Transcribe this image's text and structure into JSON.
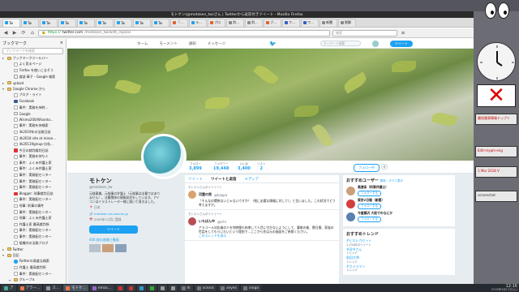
{
  "window": {
    "title": "モトケン(@motoken_tw)さん | Twitterから返答付きツイート - Mozilla Firefox"
  },
  "tabs": [
    {
      "label": "Tw",
      "color": "#1da1f2"
    },
    {
      "label": "Tw",
      "color": "#1da1f2"
    },
    {
      "label": "Tw",
      "color": "#1da1f2"
    },
    {
      "label": "Tw",
      "color": "#1da1f2"
    },
    {
      "label": "Tw",
      "color": "#1da1f2"
    },
    {
      "label": "Tw",
      "color": "#1da1f2"
    },
    {
      "label": "Tw",
      "color": "#1da1f2"
    },
    {
      "label": "Tw",
      "color": "#1da1f2"
    },
    {
      "label": "Tw",
      "color": "#1da1f2"
    },
    {
      "label": "「ホワ",
      "color": "#e06030"
    },
    {
      "label": "ライト",
      "color": "#1da1f2"
    },
    {
      "label": "ブロ",
      "color": "#e06030"
    },
    {
      "label": "判事事",
      "color": "#888888"
    },
    {
      "label": "判事事",
      "color": "#888888"
    },
    {
      "label": "ブログ",
      "color": "#e06030"
    },
    {
      "label": "フジテ",
      "color": "#3060c0"
    },
    {
      "label": "ワイド",
      "color": "#3060c0"
    },
    {
      "label": "新聞",
      "color": "#888888"
    },
    {
      "label": "脱解",
      "color": "#888888"
    }
  ],
  "nav": {
    "back": "◀",
    "forward": "▶",
    "reload": "⟳",
    "home": "⌂",
    "url_scheme": "https://",
    "url_host": "twitter.com",
    "url_path": "/motoken_tw/with_replies",
    "search_placeholder": "検索"
  },
  "sidebar": {
    "title": "ブックマーク",
    "close": "×",
    "search_placeholder": "ブックマークを検索",
    "items": [
      {
        "label": "ブックマークツールバー",
        "icon": "folder",
        "indent": 0,
        "twisty": "▸"
      },
      {
        "label": "よく見るページ",
        "icon": "page",
        "indent": 1,
        "twisty": ""
      },
      {
        "label": "Firefox を使いこなそう",
        "icon": "page",
        "indent": 1,
        "twisty": ""
      },
      {
        "label": "渡部 章子 - Google 検索",
        "icon": "google",
        "indent": 1,
        "twisty": ""
      },
      {
        "label": "upload",
        "icon": "folder",
        "indent": 0,
        "twisty": "▸"
      },
      {
        "label": "Google Chrome から",
        "icon": "folder",
        "indent": 0,
        "twisty": "▾"
      },
      {
        "label": "ブログ・ライト",
        "icon": "page",
        "indent": 1,
        "twisty": ""
      },
      {
        "label": "Facebook",
        "icon": "fb",
        "indent": 1,
        "twisty": ""
      },
      {
        "label": "事件：実務を持時...",
        "icon": "page",
        "indent": 1,
        "twisty": ""
      },
      {
        "label": "Google",
        "icon": "google",
        "indent": 1,
        "twisty": ""
      },
      {
        "label": "Wismo200/Wisonto...",
        "icon": "page",
        "indent": 1,
        "twisty": ""
      },
      {
        "label": "事件：実務を持検索",
        "icon": "page",
        "indent": 1,
        "twisty": ""
      },
      {
        "label": "dk2019年の法務日誌",
        "icon": "page",
        "indent": 1,
        "twisty": ""
      },
      {
        "label": "dk2018 site at misse...",
        "icon": "page",
        "indent": 1,
        "twisty": ""
      },
      {
        "label": "dk20119group-分析...",
        "icon": "page",
        "indent": 1,
        "twisty": ""
      },
      {
        "label": "今日の裁判裁判日誌",
        "icon": "red",
        "indent": 1,
        "twisty": ""
      },
      {
        "label": "事件：実務を持ち人",
        "icon": "page",
        "indent": 1,
        "twisty": ""
      },
      {
        "label": "事件：ふくみ弁護士家",
        "icon": "page",
        "indent": 1,
        "twisty": ""
      },
      {
        "label": "事件：ふくみ弁護士家",
        "icon": "page",
        "indent": 1,
        "twisty": ""
      },
      {
        "label": "事件：実務配センター",
        "icon": "page",
        "indent": 1,
        "twisty": ""
      },
      {
        "label": "事件：実務配センター",
        "icon": "page",
        "indent": 1,
        "twisty": ""
      },
      {
        "label": "事件：実務配センター",
        "icon": "page",
        "indent": 1,
        "twisty": ""
      },
      {
        "label": "Blogger: 刑事裁判日誌",
        "icon": "red",
        "indent": 1,
        "twisty": ""
      },
      {
        "label": "事件：実務配センター",
        "icon": "page",
        "indent": 1,
        "twisty": ""
      },
      {
        "label": "刑事: 刑事の事件",
        "icon": "page",
        "indent": 1,
        "twisty": ""
      },
      {
        "label": "事件：実務配センター",
        "icon": "page",
        "indent": 1,
        "twisty": ""
      },
      {
        "label": "刑事：ふくみ弁護士家",
        "icon": "page",
        "indent": 1,
        "twisty": ""
      },
      {
        "label": "弁護士家 最高裁判所",
        "icon": "page",
        "indent": 1,
        "twisty": ""
      },
      {
        "label": "事件：実務配センター",
        "icon": "page",
        "indent": 1,
        "twisty": ""
      },
      {
        "label": "事件：実務配センター",
        "icon": "page",
        "indent": 1,
        "twisty": ""
      },
      {
        "label": "組織内の法務ブログ",
        "icon": "page",
        "indent": 1,
        "twisty": ""
      },
      {
        "label": "Twitter",
        "icon": "folder",
        "indent": 0,
        "twisty": "▸"
      },
      {
        "label": "日記",
        "icon": "folder",
        "indent": 0,
        "twisty": "▾"
      },
      {
        "label": "Twitterの高度な検索",
        "icon": "twitter",
        "indent": 1,
        "twisty": ""
      },
      {
        "label": "弁護士 最高裁判所",
        "icon": "page",
        "indent": 1,
        "twisty": ""
      },
      {
        "label": "事件：実務配センター",
        "icon": "page",
        "indent": 1,
        "twisty": ""
      },
      {
        "label": "グループル",
        "icon": "folder",
        "indent": 1,
        "twisty": "▾"
      }
    ]
  },
  "twitter": {
    "nav": {
      "home": "ホーム",
      "moments": "モーメント",
      "notifications": "通知",
      "messages": "メッセージ",
      "search_placeholder": "キーワード検索",
      "tweet_button": "ツイート"
    },
    "stats": [
      {
        "label": "ツイート",
        "value": "199,223"
      },
      {
        "label": "フォロー",
        "value": "3,899"
      },
      {
        "label": "フォロワー",
        "value": "19,448"
      },
      {
        "label": "いいね",
        "value": "3,400"
      },
      {
        "label": "リスト",
        "value": "2"
      }
    ],
    "follow_button": "フォロー中",
    "gear": "⚙",
    "profile": {
      "name": "モトケン",
      "handle": "@motoken_tw",
      "bio": "元検事補。元検事の弁護士（元検事は法曹ではありません）。法曹関係の情報発信をしています。アイコンはイラストレーター様に描いて頂きました。",
      "location": "日本",
      "site": "motoken.na.coocan.jp",
      "joined": "2009年12月に登録",
      "tweet_to": "ツイート",
      "photos": "406 枚の画像と動画"
    },
    "timeline": {
      "tabs": [
        "ツイート",
        "ツイートと返信",
        "メディア"
      ],
      "tweets": [
        {
          "retweet": "モトケンさんがリツイート",
          "name": "河童の男",
          "handle": "@kappa",
          "body": "「そんなの関係ないじゃないですか！（他に必要な情報に対して）」と言いました。この状況でどう考えますか。",
          "link": "",
          "avatar": "#d7a36a"
        },
        {
          "retweet": "モトケンさんがリツイート",
          "name": "いちばん中",
          "handle": "@ichi",
          "body": "アラコール対応者の人を何時間も拘束して人目に付かないようにして、事故の後、数日間、家族の世話をしてもらいたいという理由で…ここから先は元の画面をご参照ください。",
          "link": "このスレッドを表示",
          "avatar": "#b94b55"
        }
      ]
    },
    "suggestions": {
      "title": "おすすめユーザー",
      "actions": "更新・すべて表示",
      "users": [
        {
          "name": "風速条（刑事弁護士）",
          "button": "フォローする",
          "avatar": "#c9a07a"
        },
        {
          "name": "東京Z日報（新聞）",
          "button": "フォローする",
          "avatar": "#d23f3f"
        },
        {
          "name": "今度藤沢 大阪でのなにか",
          "button": "フォローする",
          "avatar": "#5a7fb0"
        }
      ]
    },
    "trends": {
      "title": "おすすめトレンド",
      "items": [
        {
          "name": "#ヒロシカセット",
          "sub": "1,234件のツイート"
        },
        {
          "name": "#田中さん",
          "sub": "トレンド"
        },
        {
          "name": "前田大将",
          "sub": "トレンド"
        },
        {
          "name": "#カメラマン",
          "sub": "トレンド"
        }
      ]
    }
  },
  "desktop": {
    "minimized": [
      "最短電車情報ドップト",
      "Edit-myqm-eng",
      "1 Mar 2018 V",
      "screenshot"
    ]
  },
  "taskbar": {
    "items": [
      {
        "label": "ア",
        "color": "#4a9",
        "active": false
      },
      {
        "label": "アラー...",
        "color": "#e74",
        "active": false
      },
      {
        "label": "ス...",
        "color": "#999",
        "active": false
      },
      {
        "label": "モトケ...",
        "color": "#e74",
        "active": true
      },
      {
        "label": "emac...",
        "color": "#96c",
        "active": false
      },
      {
        "label": "",
        "color": "#c33",
        "active": false
      },
      {
        "label": "",
        "color": "#c33",
        "active": false
      },
      {
        "label": "",
        "color": "#39c",
        "active": false
      },
      {
        "label": "",
        "color": "#3a3",
        "active": false
      },
      {
        "label": "",
        "color": "#999",
        "active": false
      },
      {
        "label": "",
        "color": "#999",
        "active": false
      },
      {
        "label": "fk",
        "color": "#777",
        "active": false
      },
      {
        "label": "xclock",
        "color": "#777",
        "active": false
      },
      {
        "label": "xeyes",
        "color": "#777",
        "active": false
      },
      {
        "label": "xlogo",
        "color": "#777",
        "active": false
      }
    ],
    "time": "12:16",
    "date": "2018年9月11日(火)"
  }
}
